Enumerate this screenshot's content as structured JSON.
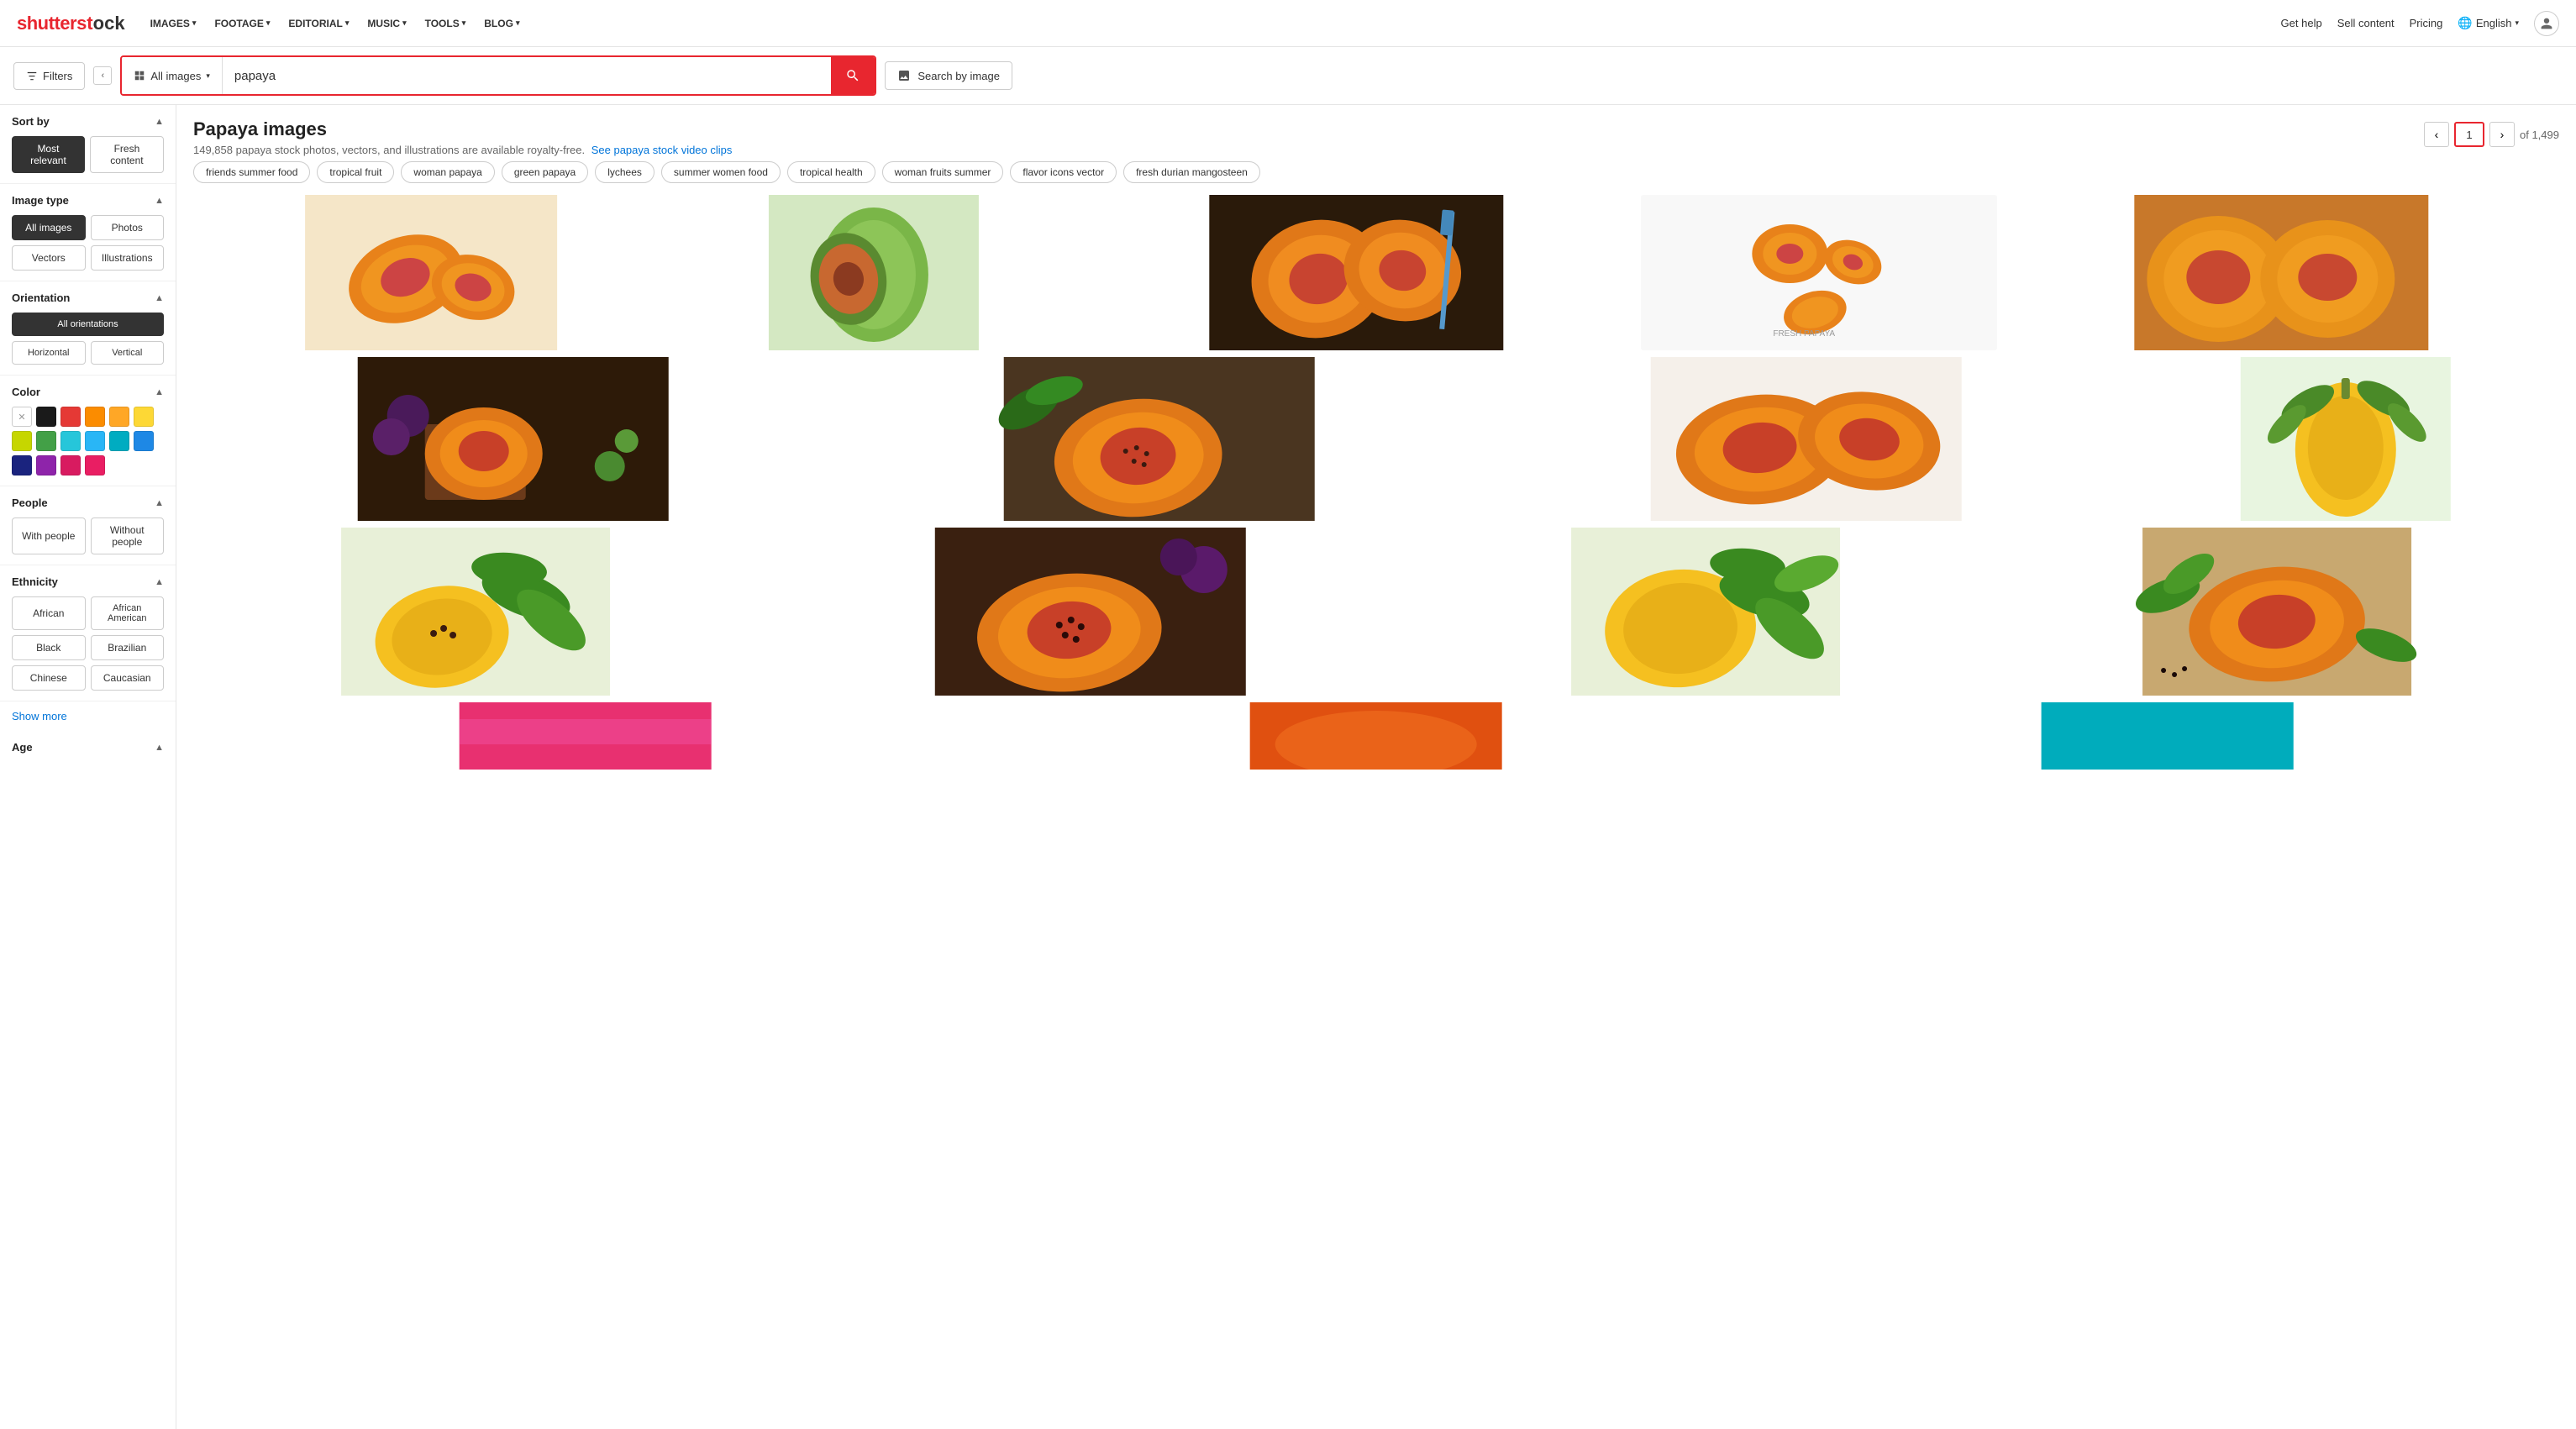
{
  "header": {
    "logo": "shutterst",
    "logo_o": "o",
    "logo_ck": "ck",
    "nav": [
      {
        "label": "IMAGES",
        "id": "nav-images"
      },
      {
        "label": "FOOTAGE",
        "id": "nav-footage"
      },
      {
        "label": "EDITORIAL",
        "id": "nav-editorial"
      },
      {
        "label": "MUSIC",
        "id": "nav-music"
      },
      {
        "label": "TOOLS",
        "id": "nav-tools"
      },
      {
        "label": "BLOG",
        "id": "nav-blog"
      }
    ],
    "help": "Get help",
    "sell": "Sell content",
    "pricing": "Pricing",
    "language": "English"
  },
  "search": {
    "type_label": "All images",
    "query": "papaya",
    "search_by_image": "Search by image"
  },
  "filters": {
    "title": "Filters",
    "sort_by": {
      "label": "Sort by",
      "options": [
        {
          "label": "Most relevant",
          "active": true
        },
        {
          "label": "Fresh content",
          "active": false
        }
      ]
    },
    "image_type": {
      "label": "Image type",
      "options": [
        {
          "label": "All images",
          "active": true
        },
        {
          "label": "Photos",
          "active": false
        },
        {
          "label": "Vectors",
          "active": false
        },
        {
          "label": "Illustrations",
          "active": false
        }
      ]
    },
    "orientation": {
      "label": "Orientation",
      "options": [
        {
          "label": "All orientations",
          "active": true
        },
        {
          "label": "Horizontal",
          "active": false
        },
        {
          "label": "Vertical",
          "active": false
        }
      ]
    },
    "color": {
      "label": "Color",
      "swatches": [
        {
          "color": "clear",
          "hex": "#fff"
        },
        {
          "color": "black",
          "hex": "#1a1a1a"
        },
        {
          "color": "red",
          "hex": "#e53935"
        },
        {
          "color": "orange",
          "hex": "#fb8c00"
        },
        {
          "color": "yellow-orange",
          "hex": "#ffa726"
        },
        {
          "color": "yellow",
          "hex": "#fdd835"
        },
        {
          "color": "yellow-green",
          "hex": "#c6d600"
        },
        {
          "color": "green",
          "hex": "#43a047"
        },
        {
          "color": "teal",
          "hex": "#26c6da"
        },
        {
          "color": "light-blue",
          "hex": "#29b6f6"
        },
        {
          "color": "cyan",
          "hex": "#00acc1"
        },
        {
          "color": "blue",
          "hex": "#1e88e5"
        },
        {
          "color": "dark-blue",
          "hex": "#1a237e"
        },
        {
          "color": "purple",
          "hex": "#8e24aa"
        },
        {
          "color": "magenta",
          "hex": "#d81b60"
        },
        {
          "color": "pink",
          "hex": "#e91e63"
        }
      ]
    },
    "people": {
      "label": "People",
      "options": [
        {
          "label": "With people"
        },
        {
          "label": "Without people"
        }
      ]
    },
    "ethnicity": {
      "label": "Ethnicity",
      "options": [
        {
          "label": "African"
        },
        {
          "label": "African American"
        },
        {
          "label": "Black"
        },
        {
          "label": "Brazilian"
        },
        {
          "label": "Chinese"
        },
        {
          "label": "Caucasian"
        }
      ]
    },
    "show_more": "Show more",
    "age": {
      "label": "Age"
    }
  },
  "main": {
    "title": "Papaya images",
    "subtitle": "149,858 papaya stock photos, vectors, and illustrations are available royalty-free.",
    "see_video": "See papaya stock video clips",
    "tags": [
      "friends summer food",
      "tropical fruit",
      "woman papaya",
      "green papaya",
      "lychees",
      "summer women food",
      "tropical health",
      "woman fruits summer",
      "flavor icons vector",
      "fresh durian mangosteen"
    ],
    "pagination": {
      "current": "1",
      "total": "of 1,499",
      "prev": "‹",
      "next": "›"
    }
  }
}
